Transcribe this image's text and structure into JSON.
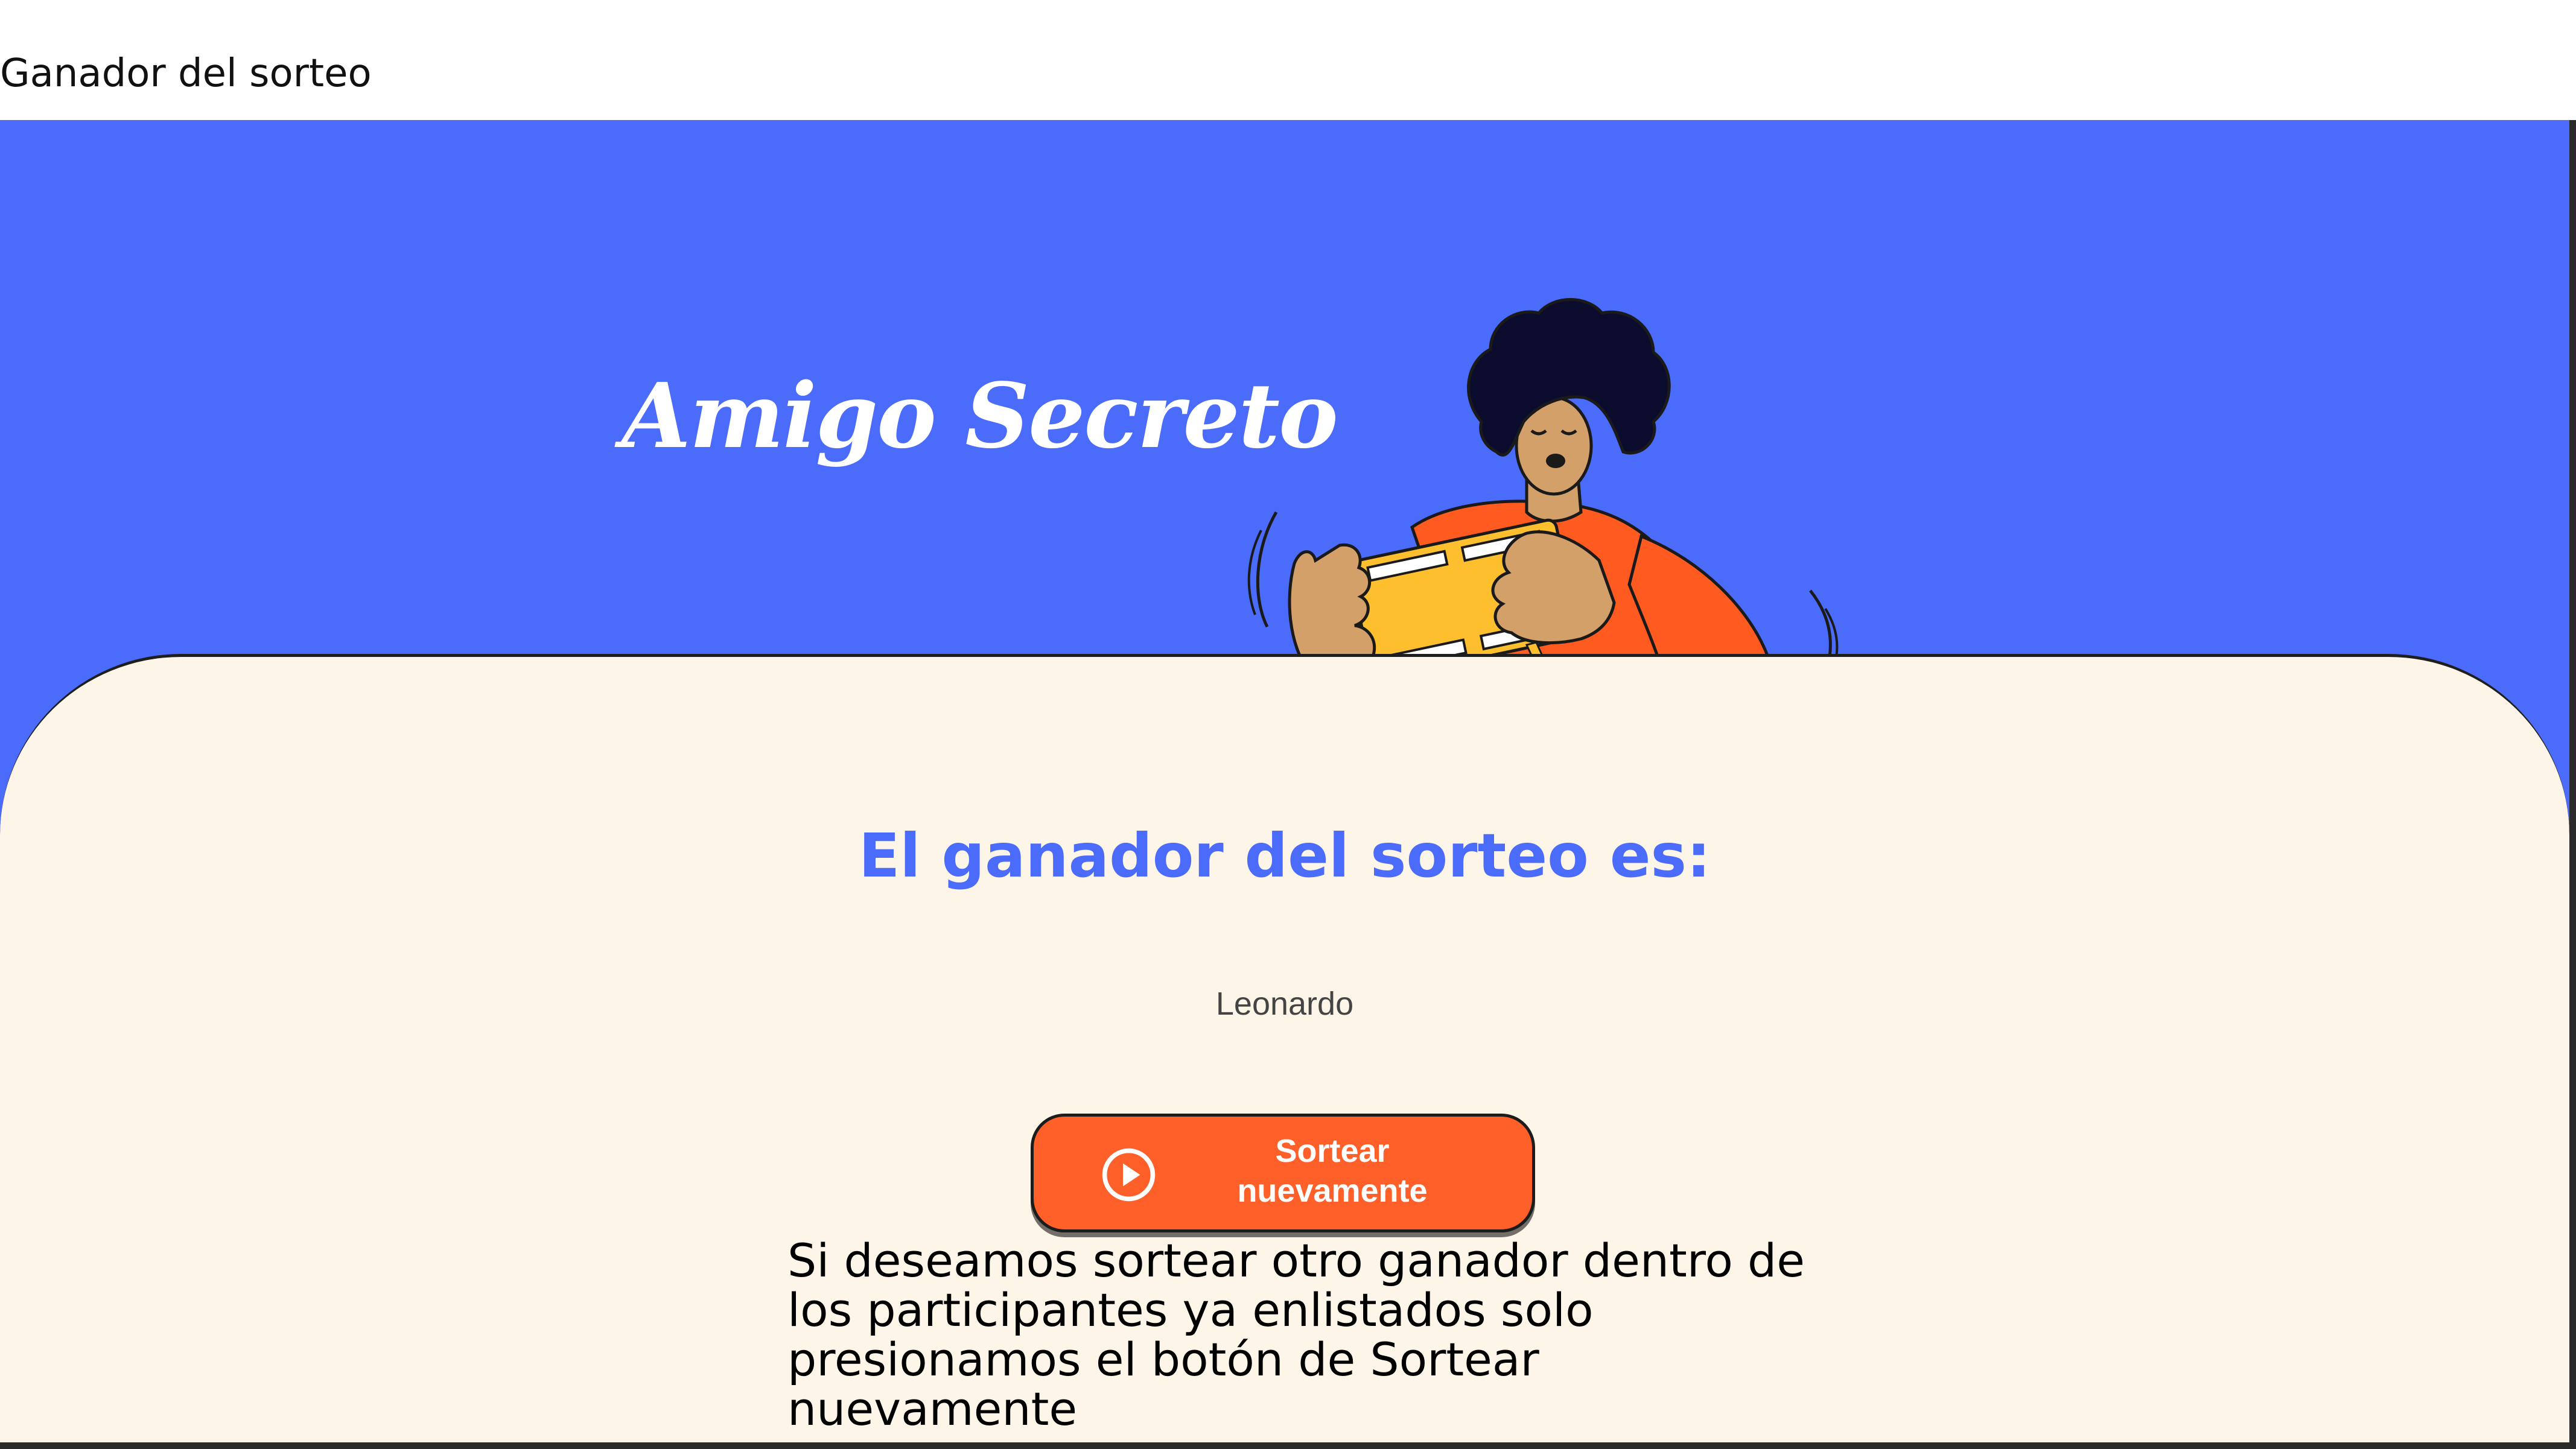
{
  "page": {
    "caption": "Ganador del sorteo"
  },
  "hero": {
    "title": "Amigo Secreto",
    "illustration_icon": "person-shaking-gift-box-illustration"
  },
  "result": {
    "heading": "El ganador del sorteo es:",
    "winner_name": "Leonardo"
  },
  "actions": {
    "redraw_label": "Sortear nuevamente",
    "redraw_icon": "play-circle-icon"
  },
  "help": {
    "text": "Si deseamos sortear otro ganador dentro de los participantes ya enlistados solo presionamos el botón de Sortear nuevamente"
  },
  "colors": {
    "header_background": "#4b6bfb",
    "panel_background": "#fdf6e8",
    "accent_blue": "#4b6bfb",
    "button_orange": "#ff6029",
    "illustration_orange": "#ff5a1f",
    "box_yellow": "#fdbf2d",
    "skin_tan": "#d4a06a"
  }
}
